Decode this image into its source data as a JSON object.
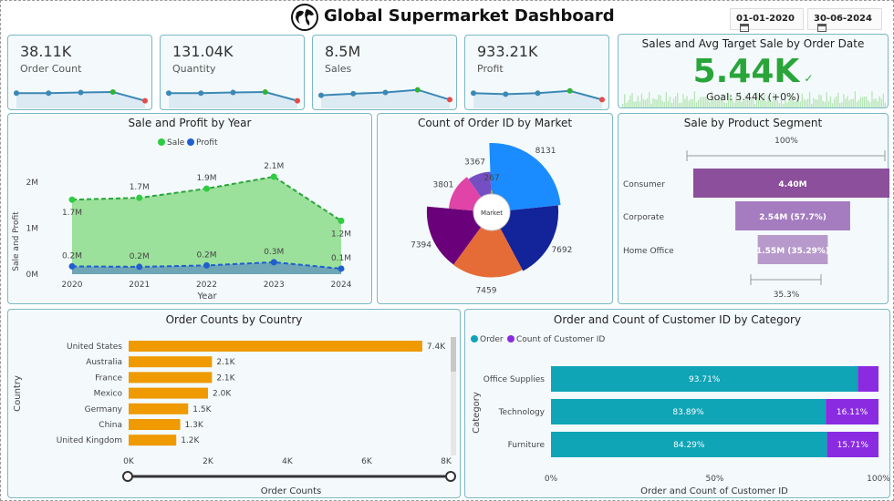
{
  "header": {
    "title": "Global Supermarket Dashboard",
    "start_date": "01-01-2020",
    "end_date": "30-06-2024"
  },
  "kpis": [
    {
      "value": "38.11K",
      "label": "Order Count"
    },
    {
      "value": "131.04K",
      "label": "Quantity"
    },
    {
      "value": "8.5M",
      "label": "Sales"
    },
    {
      "value": "933.21K",
      "label": "Profit"
    }
  ],
  "target": {
    "title": "Sales and Avg Target Sale by Order Date",
    "value": "5.44K",
    "check": "✓",
    "goal": "Goal: 5.44K (+0%)"
  },
  "colors": {
    "sale": "#2ecc40",
    "profit": "#1f5fcf",
    "bar": "#ee9a00",
    "order": "#0fa4b6",
    "customer": "#8a2be2"
  },
  "chart_data": [
    {
      "type": "area",
      "title": "Sale and Profit by Year",
      "xlabel": "Year",
      "ylabel": "Sale and Profit",
      "categories": [
        "2020",
        "2021",
        "2022",
        "2023",
        "2024"
      ],
      "ylim": [
        0,
        2.5
      ],
      "yticks": [
        "0M",
        "1M",
        "2M"
      ],
      "series": [
        {
          "name": "Sale",
          "values": [
            1.62,
            1.66,
            1.86,
            2.12,
            1.16
          ],
          "labels": [
            "1.7M",
            "1.7M",
            "1.9M",
            "2.1M",
            "1.2M"
          ]
        },
        {
          "name": "Profit",
          "values": [
            0.17,
            0.16,
            0.19,
            0.26,
            0.12
          ],
          "labels": [
            "0.2M",
            "0.2M",
            "0.2M",
            "0.3M",
            "0.1M"
          ]
        }
      ],
      "legend": "top"
    },
    {
      "type": "pie",
      "title": "Count of Order ID by Market",
      "center_label": "Market",
      "slices": [
        {
          "value": 8131,
          "label": "8131",
          "color": "#1a8cff"
        },
        {
          "value": 7692,
          "label": "7692",
          "color": "#13239a"
        },
        {
          "value": 7459,
          "label": "7459",
          "color": "#e66c37"
        },
        {
          "value": 7394,
          "label": "7394",
          "color": "#6b007b"
        },
        {
          "value": 3801,
          "label": "3801",
          "color": "#e044a7"
        },
        {
          "value": 3367,
          "label": "3367",
          "color": "#744ec2"
        },
        {
          "value": 267,
          "label": "267",
          "color": "#d9b300"
        }
      ]
    },
    {
      "type": "bar",
      "title": "Sale by Product Segment",
      "top_label": "100%",
      "bottom_label": "35.3%",
      "categories": [
        "Consumer",
        "Corporate",
        "Home Office"
      ],
      "values": [
        4.4,
        2.54,
        1.55
      ],
      "labels": [
        "4.40M",
        "2.54M (57.7%)",
        "1.55M (35.29%)"
      ],
      "colors": [
        "#8b4f9b",
        "#a57cc0",
        "#b79acb"
      ]
    },
    {
      "type": "bar",
      "title": "Order Counts by Country",
      "xlabel": "Order Counts",
      "ylabel": "Country",
      "categories": [
        "United States",
        "Australia",
        "France",
        "Mexico",
        "Germany",
        "China",
        "United Kingdom"
      ],
      "values": [
        7.4,
        2.1,
        2.1,
        2.0,
        1.5,
        1.3,
        1.2
      ],
      "labels": [
        "7.4K",
        "2.1K",
        "2.1K",
        "2.0K",
        "1.5K",
        "1.3K",
        "1.2K"
      ],
      "xticks": [
        "0K",
        "2K",
        "4K",
        "6K",
        "8K"
      ],
      "xlim": [
        0,
        8
      ]
    },
    {
      "type": "bar",
      "title": "Order and Count of Customer ID by Category",
      "xlabel": "Order and Count of Customer ID",
      "ylabel": "Category",
      "categories": [
        "Office Supplies",
        "Technology",
        "Furniture"
      ],
      "series": [
        {
          "name": "Order",
          "values": [
            93.71,
            83.89,
            84.29
          ],
          "labels": [
            "93.71%",
            "83.89%",
            "84.29%"
          ]
        },
        {
          "name": "Count of Customer ID",
          "values": [
            6.29,
            16.11,
            15.71
          ],
          "labels": [
            "",
            "16.11%",
            "15.71%"
          ]
        }
      ],
      "xticks": [
        "0%",
        "50%",
        "100%"
      ]
    }
  ],
  "sparklines": [
    [
      0.55,
      0.55,
      0.52,
      0.5,
      0.9
    ],
    [
      0.55,
      0.55,
      0.52,
      0.5,
      0.9
    ],
    [
      0.65,
      0.58,
      0.52,
      0.4,
      0.85
    ],
    [
      0.55,
      0.6,
      0.55,
      0.45,
      0.85
    ]
  ]
}
